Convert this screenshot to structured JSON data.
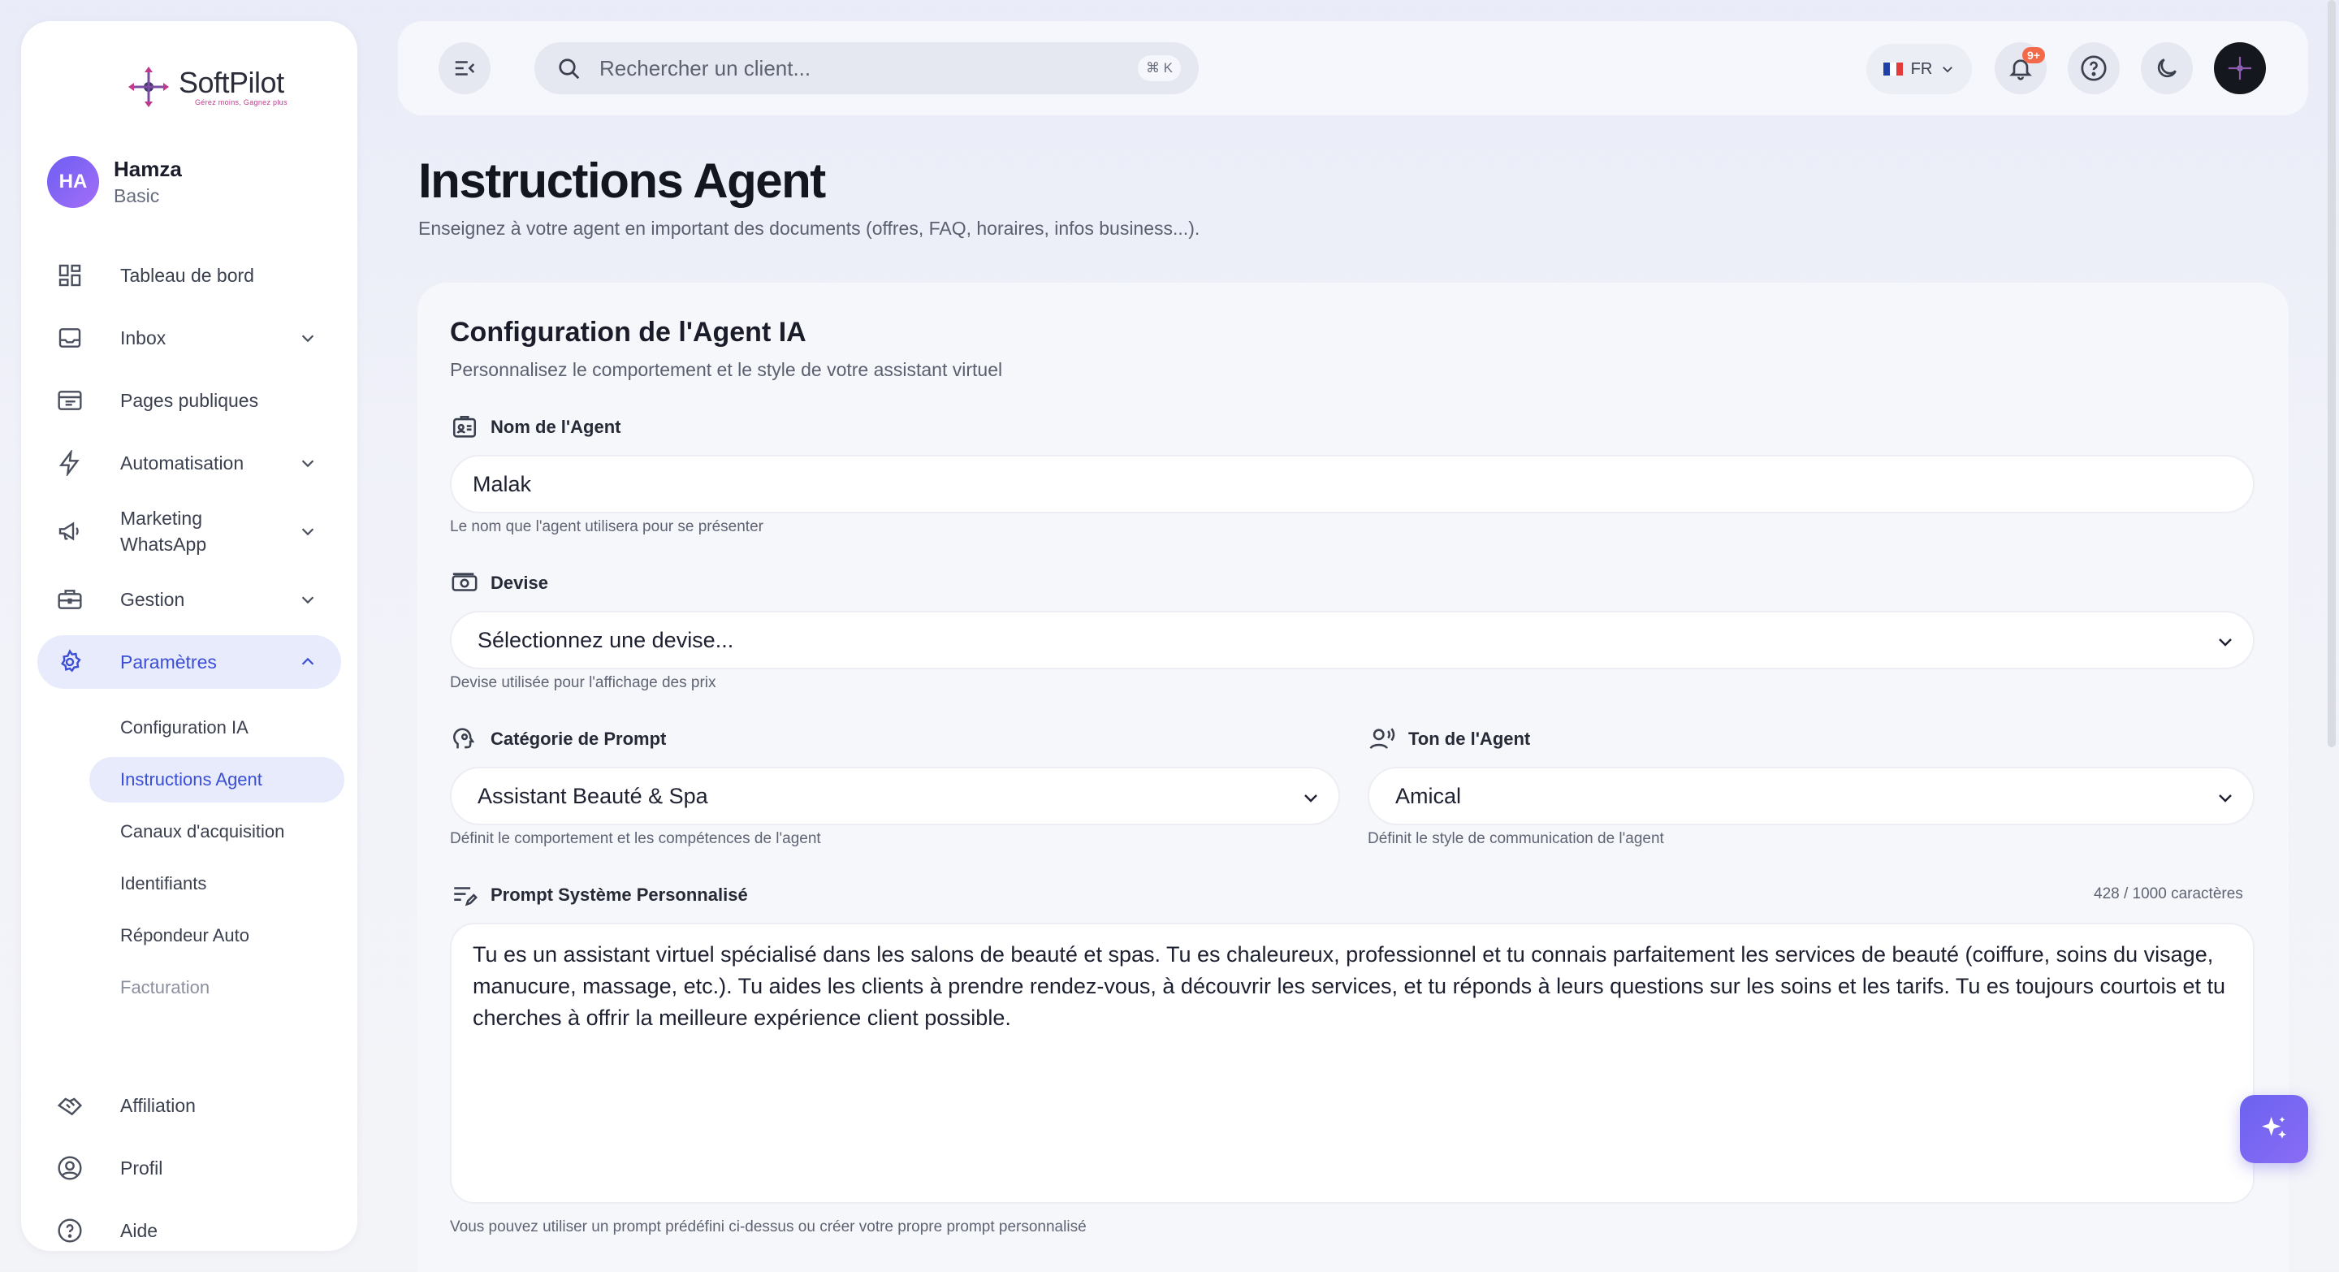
{
  "brand": {
    "name": "SoftPilot",
    "tagline": "Gérez moins, Gagnez plus"
  },
  "user": {
    "initials": "HA",
    "name": "Hamza",
    "plan": "Basic"
  },
  "sidebar": {
    "items": [
      {
        "label": "Tableau de bord",
        "icon": "dashboard-icon"
      },
      {
        "label": "Inbox",
        "icon": "inbox-icon"
      },
      {
        "label": "Pages publiques",
        "icon": "browser-icon"
      },
      {
        "label": "Automatisation",
        "icon": "bolt-icon"
      },
      {
        "label": "Marketing WhatsApp",
        "line1": "Marketing",
        "line2": "WhatsApp",
        "icon": "megaphone-icon"
      },
      {
        "label": "Gestion",
        "icon": "briefcase-icon"
      },
      {
        "label": "Paramètres",
        "icon": "gear-icon"
      }
    ],
    "subitems": [
      {
        "label": "Configuration IA"
      },
      {
        "label": "Instructions Agent"
      },
      {
        "label": "Canaux d'acquisition"
      },
      {
        "label": "Identifiants"
      },
      {
        "label": "Répondeur Auto"
      },
      {
        "label": "Facturation"
      }
    ],
    "bottom": [
      {
        "label": "Affiliation",
        "icon": "handshake-icon"
      },
      {
        "label": "Profil",
        "icon": "user-circle-icon"
      },
      {
        "label": "Aide",
        "icon": "help-icon"
      }
    ]
  },
  "topbar": {
    "search_placeholder": "Rechercher un client...",
    "shortcut": "⌘ K",
    "language": "FR",
    "notifications_badge": "9+"
  },
  "page": {
    "title": "Instructions Agent",
    "subtitle": "Enseignez à votre agent en important des documents (offres, FAQ, horaires, infos business...)."
  },
  "card": {
    "title": "Configuration de l'Agent IA",
    "subtitle": "Personnalisez le comportement et le style de votre assistant virtuel",
    "agent_name": {
      "label": "Nom de l'Agent",
      "value": "Malak",
      "help": "Le nom que l'agent utilisera pour se présenter"
    },
    "currency": {
      "label": "Devise",
      "value": "Sélectionnez une devise...",
      "help": "Devise utilisée pour l'affichage des prix"
    },
    "prompt_category": {
      "label": "Catégorie de Prompt",
      "value": "Assistant Beauté & Spa",
      "help": "Définit le comportement et les compétences de l'agent"
    },
    "tone": {
      "label": "Ton de l'Agent",
      "value": "Amical",
      "help": "Définit le style de communication de l'agent"
    },
    "system_prompt": {
      "label": "Prompt Système Personnalisé",
      "counter": "428 / 1000 caractères",
      "value": "Tu es un assistant virtuel spécialisé dans les salons de beauté et spas. Tu es chaleureux, professionnel et tu connais parfaitement les services de beauté (coiffure, soins du visage, manucure, massage, etc.). Tu aides les clients à prendre rendez-vous, à découvrir les services, et tu réponds à leurs questions sur les soins et les tarifs. Tu es toujours courtois et tu cherches à offrir la meilleure expérience client possible.",
      "help": "Vous pouvez utiliser un prompt prédéfini ci-dessus ou créer votre propre prompt personnalisé"
    }
  },
  "colors": {
    "accent": "#3a4ed6",
    "active_bg": "#e8ebfb",
    "fab": "#6b63f0",
    "badge": "#f36a4a"
  }
}
